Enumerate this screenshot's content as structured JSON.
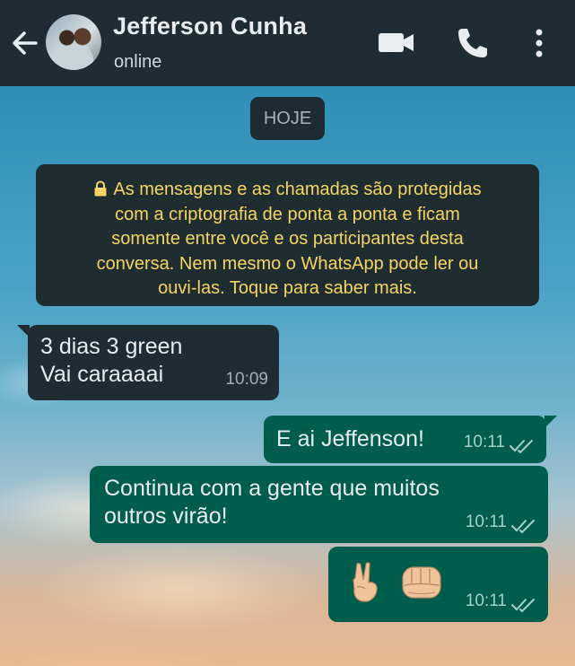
{
  "header": {
    "contact_name": "Jefferson Cunha",
    "status": "online",
    "icons": [
      "back-arrow-icon",
      "video-call-icon",
      "phone-icon",
      "more-vert-icon"
    ]
  },
  "date_chip": "HOJE",
  "encryption_notice": {
    "icon": "lock-icon",
    "lines": [
      "As mensagens e as chamadas são protegidas",
      "com a criptografia de ponta a ponta e ficam",
      "somente entre você e os participantes desta",
      "conversa. Nem mesmo o WhatsApp pode ler ou",
      "ouvi-las. Toque para saber mais."
    ]
  },
  "messages": [
    {
      "direction": "incoming",
      "lines": [
        "3 dias 3 green",
        "Vai caraaaai"
      ],
      "time": "10:09"
    },
    {
      "direction": "outgoing",
      "lines": [
        "E ai Jeffenson!"
      ],
      "time": "10:11",
      "status": "read"
    },
    {
      "direction": "outgoing",
      "lines": [
        "Continua com a gente que muitos",
        "outros virão!"
      ],
      "time": "10:11",
      "status": "read"
    },
    {
      "direction": "outgoing",
      "emojis": [
        "victory-hand-icon",
        "oncoming-fist-icon"
      ],
      "time": "10:11",
      "status": "read"
    }
  ],
  "colors": {
    "header_bg": "#1f2c34",
    "incoming_bubble": "#1f2c34",
    "outgoing_bubble": "#005c4b",
    "notice_text": "#f4d565",
    "read_ticks": "#a5d1c7"
  }
}
